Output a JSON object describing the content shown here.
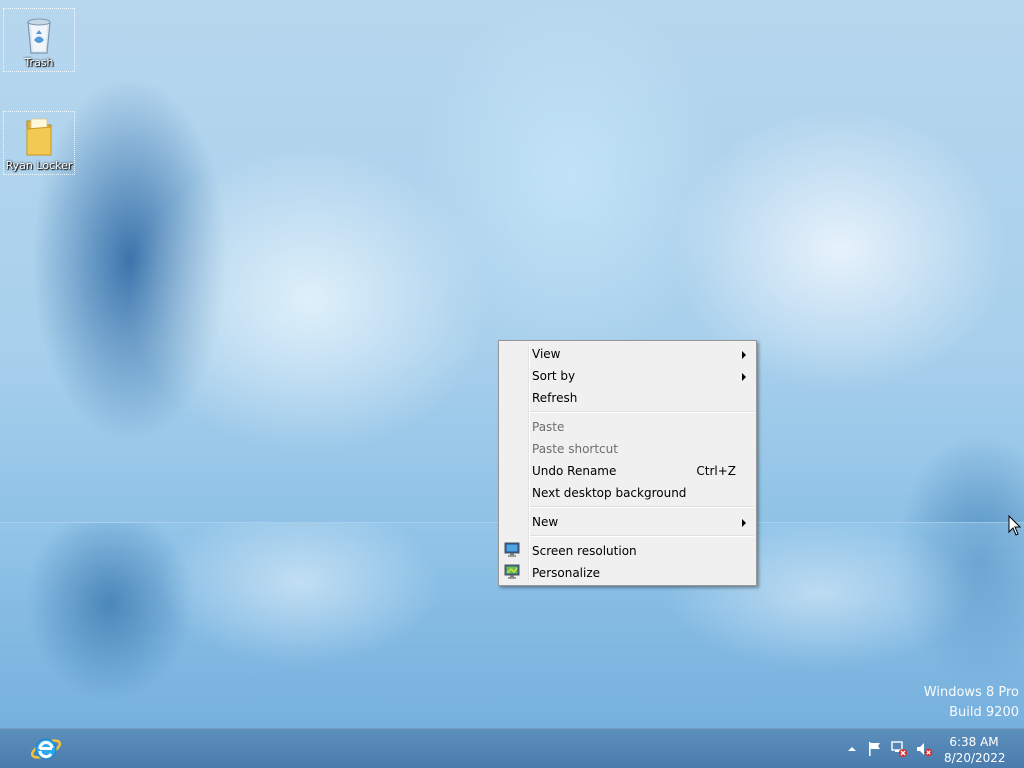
{
  "desktop": {
    "icons": [
      {
        "label": "Trash",
        "icon": "recycle-bin-icon"
      },
      {
        "label": "Ryan Locker",
        "icon": "folder-icon"
      }
    ],
    "watermark": {
      "line1": "Windows 8 Pro",
      "line2": "Build 9200"
    }
  },
  "context_menu": {
    "items": [
      {
        "label": "View",
        "submenu": true
      },
      {
        "label": "Sort by",
        "submenu": true
      },
      {
        "label": "Refresh"
      },
      {
        "label": "Paste",
        "disabled": true
      },
      {
        "label": "Paste shortcut",
        "disabled": true
      },
      {
        "label": "Undo Rename",
        "shortcut": "Ctrl+Z"
      },
      {
        "label": "Next desktop background"
      },
      {
        "label": "New",
        "submenu": true
      },
      {
        "label": "Screen resolution",
        "icon": "screen-resolution-icon"
      },
      {
        "label": "Personalize",
        "icon": "personalize-icon"
      }
    ]
  },
  "taskbar": {
    "pinned": [
      {
        "icon": "internet-explorer-icon"
      }
    ],
    "tray": {
      "icons": [
        "show-hidden-icons-chevron",
        "action-center-flag-icon",
        "network-disconnected-icon",
        "volume-muted-icon"
      ],
      "time": "6:38 AM",
      "date": "8/20/2022"
    }
  },
  "colors": {
    "taskbar": "#5a8cb9",
    "menu_background": "#f0f0f0",
    "menu_border": "#979797",
    "disabled_text": "#6d6d6d"
  }
}
